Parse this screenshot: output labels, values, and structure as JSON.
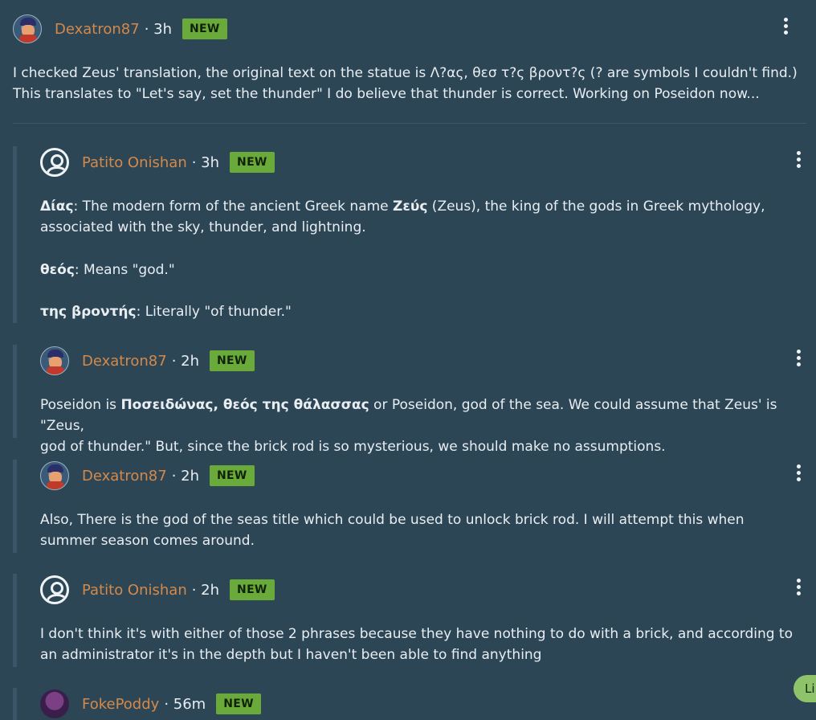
{
  "posts": [
    {
      "user": "Dexatron87",
      "time": "· 3h",
      "badge": "NEW",
      "lines": [
        "I checked Zeus' translation, the original text on the statue is Λ?ας, θεσ τ?ς βροντ?ς (? are symbols I couldn't find.)",
        "This translates to \"Let's say, set the thunder\" I do believe that thunder is correct. Working on Poseidon now..."
      ]
    },
    {
      "user": "Patito Onishan",
      "time": "· 3h",
      "badge": "NEW",
      "p1_term": "Δίας",
      "p1_a": ": The modern form of the ancient Greek name ",
      "p1_term2": "Ζεύς",
      "p1_b": " (Zeus), the king of the gods in Greek mythology,",
      "p1_c": "associated with the sky, thunder, and lightning.",
      "p2_term": "θεός",
      "p2_text": ": Means \"god.\"",
      "p3_term": "της βροντής",
      "p3_text": ": Literally \"of thunder.\""
    },
    {
      "user": "Dexatron87",
      "time": "· 2h",
      "badge": "NEW",
      "a": "Poseidon is ",
      "term": "Ποσειδώνας, θεός της θάλασσας",
      "b": " or Poseidon, god of the sea. We could assume that Zeus' is \"Zeus,",
      "c": "god of thunder.\" But, since the brick rod is so mysterious, we should make no assumptions."
    },
    {
      "user": "Dexatron87",
      "time": "· 2h",
      "badge": "NEW",
      "lines": [
        "Also, There is the god of the seas title which could be used to unlock brick rod. I will attempt this when",
        "summer season comes around."
      ]
    },
    {
      "user": "Patito Onishan",
      "time": "· 2h",
      "badge": "NEW",
      "lines": [
        "I don't think it's with either of those 2 phrases because they have nothing to do with a brick, and according to",
        "an administrator it's in the depth but I haven't been able to find anything"
      ]
    },
    {
      "user": "FokePoddy",
      "time": "· 56m",
      "badge": "NEW"
    }
  ],
  "live_button": "Li"
}
